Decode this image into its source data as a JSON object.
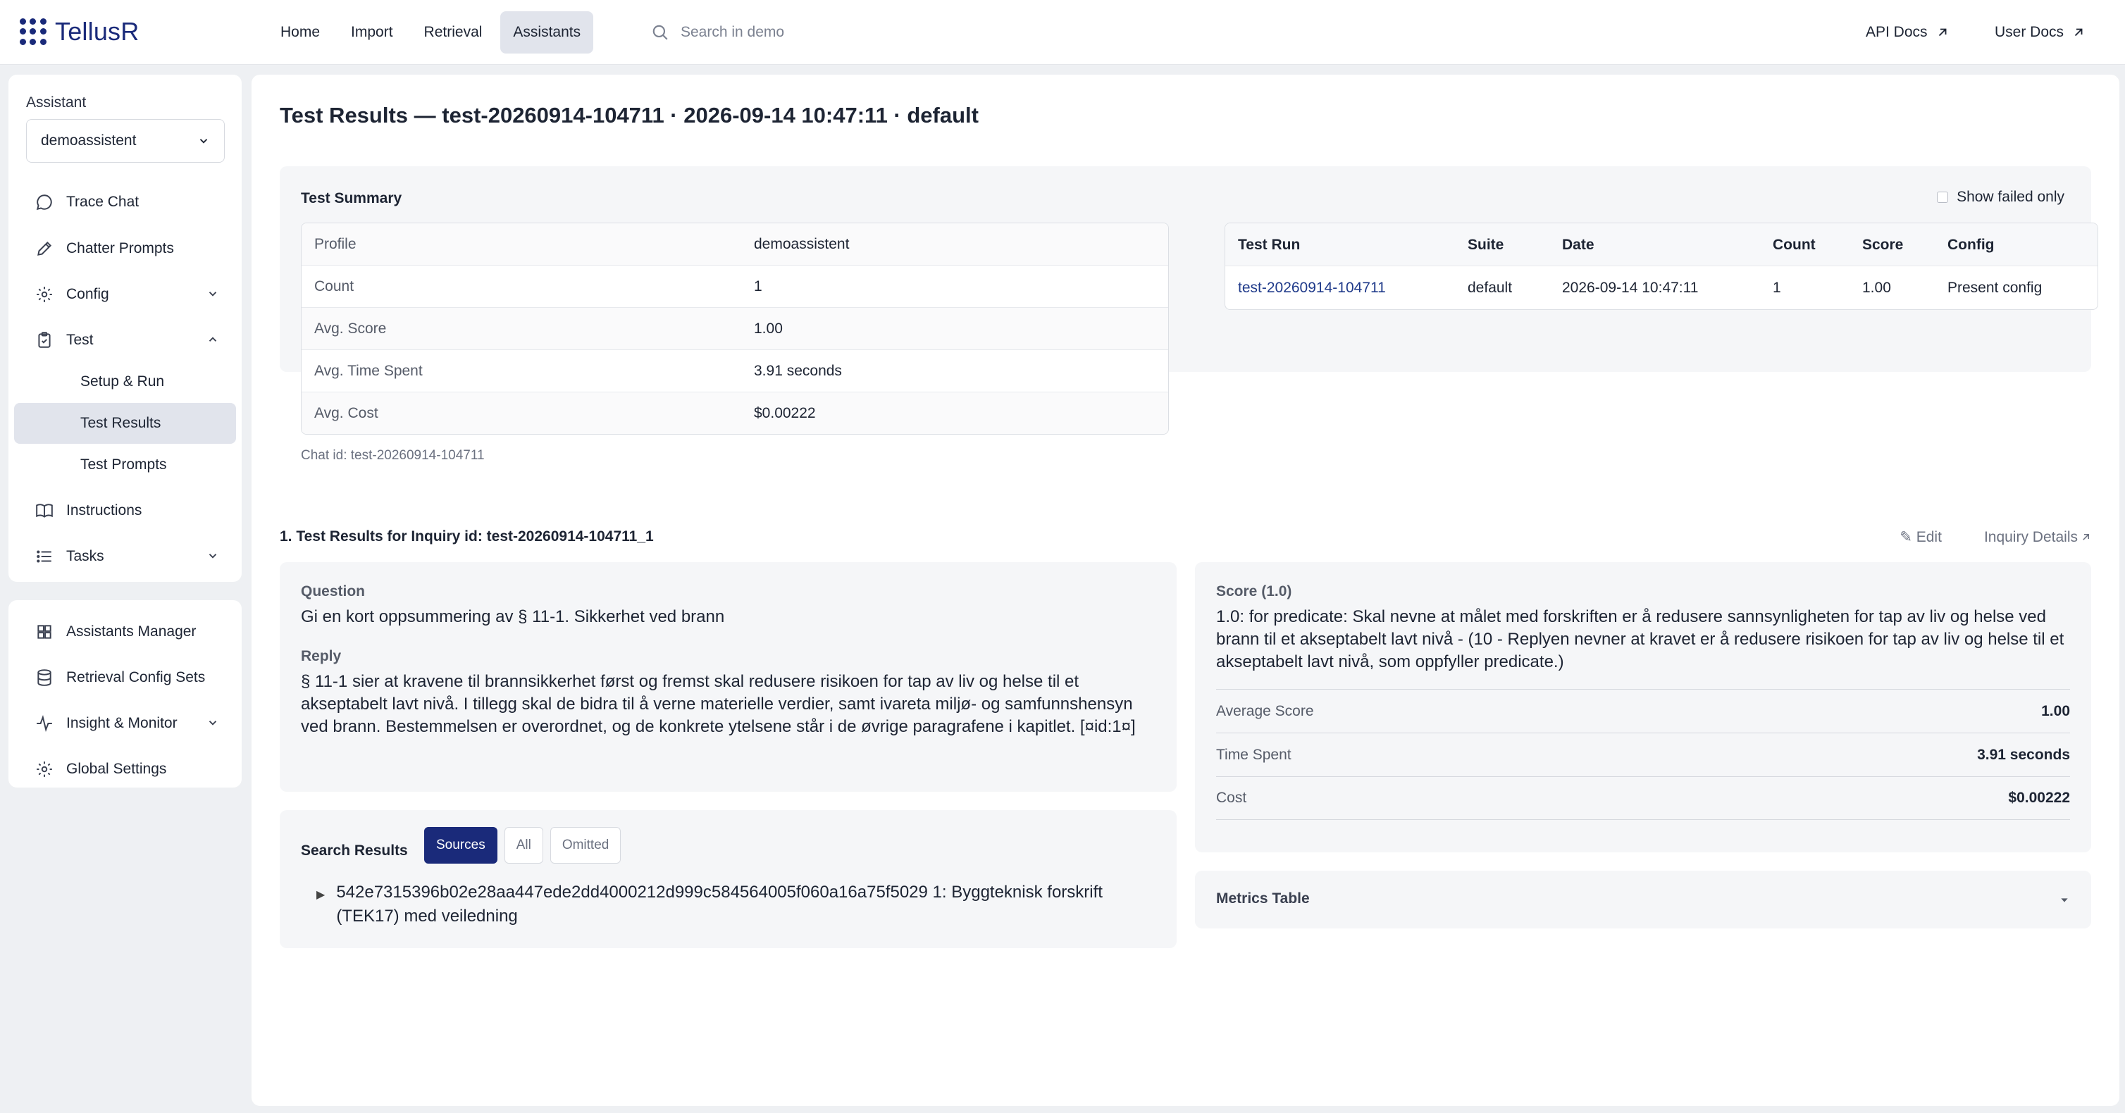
{
  "app": {
    "name": "TellusR"
  },
  "nav": {
    "items": [
      {
        "label": "Home",
        "active": false
      },
      {
        "label": "Import",
        "active": false
      },
      {
        "label": "Retrieval",
        "active": false
      },
      {
        "label": "Assistants",
        "active": true
      }
    ],
    "search_placeholder": "Search in demo",
    "api_docs": "API Docs",
    "user_docs": "User Docs"
  },
  "sidebar": {
    "assistant_label": "Assistant",
    "assistant_value": "demoassistent",
    "items": [
      {
        "label": "Trace Chat",
        "icon": "chat-bubble-icon"
      },
      {
        "label": "Chatter Prompts",
        "icon": "pencil-icon"
      },
      {
        "label": "Config",
        "icon": "gear-icon"
      },
      {
        "label": "Test",
        "icon": "clipboard-icon"
      },
      {
        "label": "Setup & Run"
      },
      {
        "label": "Test Results",
        "selected": true
      },
      {
        "label": "Test Prompts"
      },
      {
        "label": "Instructions",
        "icon": "book-icon"
      },
      {
        "label": "Tasks",
        "icon": "list-icon"
      }
    ],
    "secondary": [
      {
        "label": "Assistants Manager",
        "icon": "grid-icon"
      },
      {
        "label": "Retrieval Config Sets",
        "icon": "database-icon"
      },
      {
        "label": "Insight & Monitor",
        "icon": "activity-icon"
      },
      {
        "label": "Global Settings",
        "icon": "gear-icon"
      }
    ]
  },
  "page": {
    "title": "Test Results — test-20260914-104711 · 2026-09-14 10:47:11 · default"
  },
  "summary": {
    "title": "Test Summary",
    "show_failed_label": "Show failed only",
    "rows": [
      {
        "key": "Profile",
        "value": "demoassistent"
      },
      {
        "key": "Count",
        "value": "1"
      },
      {
        "key": "Avg. Score",
        "value": "1.00"
      },
      {
        "key": "Avg. Time Spent",
        "value": "3.91 seconds"
      },
      {
        "key": "Avg. Cost",
        "value": "$0.00222"
      }
    ],
    "chat_id": "Chat id: test-20260914-104711"
  },
  "runs": {
    "headers": [
      "Test Run",
      "Suite",
      "Date",
      "Count",
      "Score",
      "Config"
    ],
    "rows": [
      [
        "test-20260914-104711",
        "default",
        "2026-09-14 10:47:11",
        "1",
        "1.00",
        "Present config"
      ]
    ]
  },
  "inquiry": {
    "heading": "1. Test Results for Inquiry id: test-20260914-104711_1",
    "edit": "✎ Edit",
    "details": "Inquiry Details",
    "question_label": "Question",
    "question": "Gi en kort oppsummering av § 11-1. Sikkerhet ved brann",
    "reply_label": "Reply",
    "reply": "§ 11-1 sier at kravene til brannsikkerhet først og fremst skal redusere risikoen for tap av liv og helse til et akseptabelt lavt nivå. I tillegg skal de bidra til å verne materielle verdier, samt ivareta miljø- og samfunnshensyn ved brann. Bestemmelsen er overordnet, og de konkrete ytelsene står i de øvrige paragrafene i kapitlet. [¤id:1¤]"
  },
  "search_results": {
    "title": "Search Results",
    "tabs": [
      {
        "label": "Sources",
        "active": true
      },
      {
        "label": "All",
        "active": false
      },
      {
        "label": "Omitted",
        "active": false
      }
    ],
    "item": "542e7315396b02e28aa447ede2dd4000212d999c584564005f060a16a75f5029 1: Byggteknisk forskrift (TEK17) med veiledning"
  },
  "score": {
    "label": "Score (1.0)",
    "text": "1.0: for predicate: Skal nevne at målet med forskriften er å redusere sannsynligheten for tap av liv og helse ved brann til et akseptabelt lavt nivå - (10 - Replyen nevner at kravet er å redusere risikoen for tap av liv og helse til et akseptabelt lavt nivå, som oppfyller predicate.)",
    "rows": [
      {
        "key": "Average Score",
        "value": "1.00"
      },
      {
        "key": "Time Spent",
        "value": "3.91 seconds"
      },
      {
        "key": "Cost",
        "value": "$0.00222"
      }
    ]
  },
  "metrics": {
    "title": "Metrics Table"
  }
}
